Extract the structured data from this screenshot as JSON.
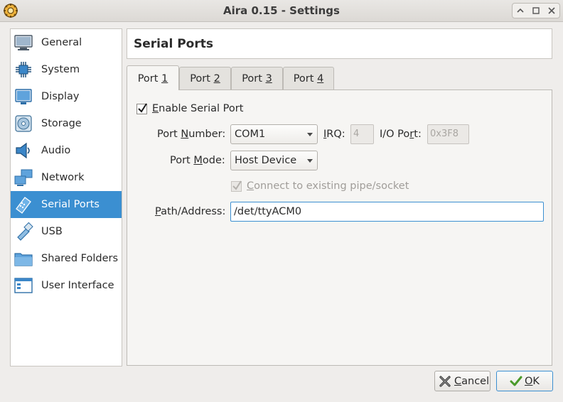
{
  "window": {
    "title": "Aira 0.15 - Settings",
    "controls": [
      "keep-above",
      "minimize",
      "maximize",
      "close"
    ]
  },
  "sidebar": {
    "items": [
      {
        "label": "General",
        "icon": "monitor-icon"
      },
      {
        "label": "System",
        "icon": "chip-icon"
      },
      {
        "label": "Display",
        "icon": "display-icon"
      },
      {
        "label": "Storage",
        "icon": "disc-icon"
      },
      {
        "label": "Audio",
        "icon": "speaker-icon"
      },
      {
        "label": "Network",
        "icon": "network-icon"
      },
      {
        "label": "Serial Ports",
        "icon": "serial-port-icon",
        "selected": true
      },
      {
        "label": "USB",
        "icon": "usb-icon"
      },
      {
        "label": "Shared Folders",
        "icon": "folder-icon"
      },
      {
        "label": "User Interface",
        "icon": "window-icon"
      }
    ]
  },
  "header": {
    "title": "Serial Ports"
  },
  "tabs": [
    {
      "prefix": "Port ",
      "mnemonic": "1",
      "active": true
    },
    {
      "prefix": "Port ",
      "mnemonic": "2"
    },
    {
      "prefix": "Port ",
      "mnemonic": "3"
    },
    {
      "prefix": "Port ",
      "mnemonic": "4"
    }
  ],
  "form": {
    "enable": {
      "mnemonic": "E",
      "rest": "nable Serial Port",
      "checked": true
    },
    "port_number": {
      "pre": "Port ",
      "mnemonic": "N",
      "post": "umber:",
      "value": "COM1"
    },
    "irq": {
      "mnemonic": "I",
      "post": "RQ:",
      "value": "4"
    },
    "io_port": {
      "pre": "I/O Po",
      "mnemonic": "r",
      "post": "t:",
      "value": "0x3F8"
    },
    "port_mode": {
      "pre": "Port ",
      "mnemonic": "M",
      "post": "ode:",
      "value": "Host Device"
    },
    "connect": {
      "mnemonic": "C",
      "rest": "onnect to existing pipe/socket",
      "checked": true,
      "disabled": true
    },
    "path": {
      "mnemonic": "P",
      "post": "ath/Address:",
      "value": "/det/ttyACM0"
    }
  },
  "buttons": {
    "cancel": {
      "mnemonic": "C",
      "rest": "ancel"
    },
    "ok": {
      "mnemonic": "O",
      "rest": "K"
    }
  },
  "colors": {
    "accent": "#3b8fd1",
    "window_bg": "#efedeb"
  }
}
